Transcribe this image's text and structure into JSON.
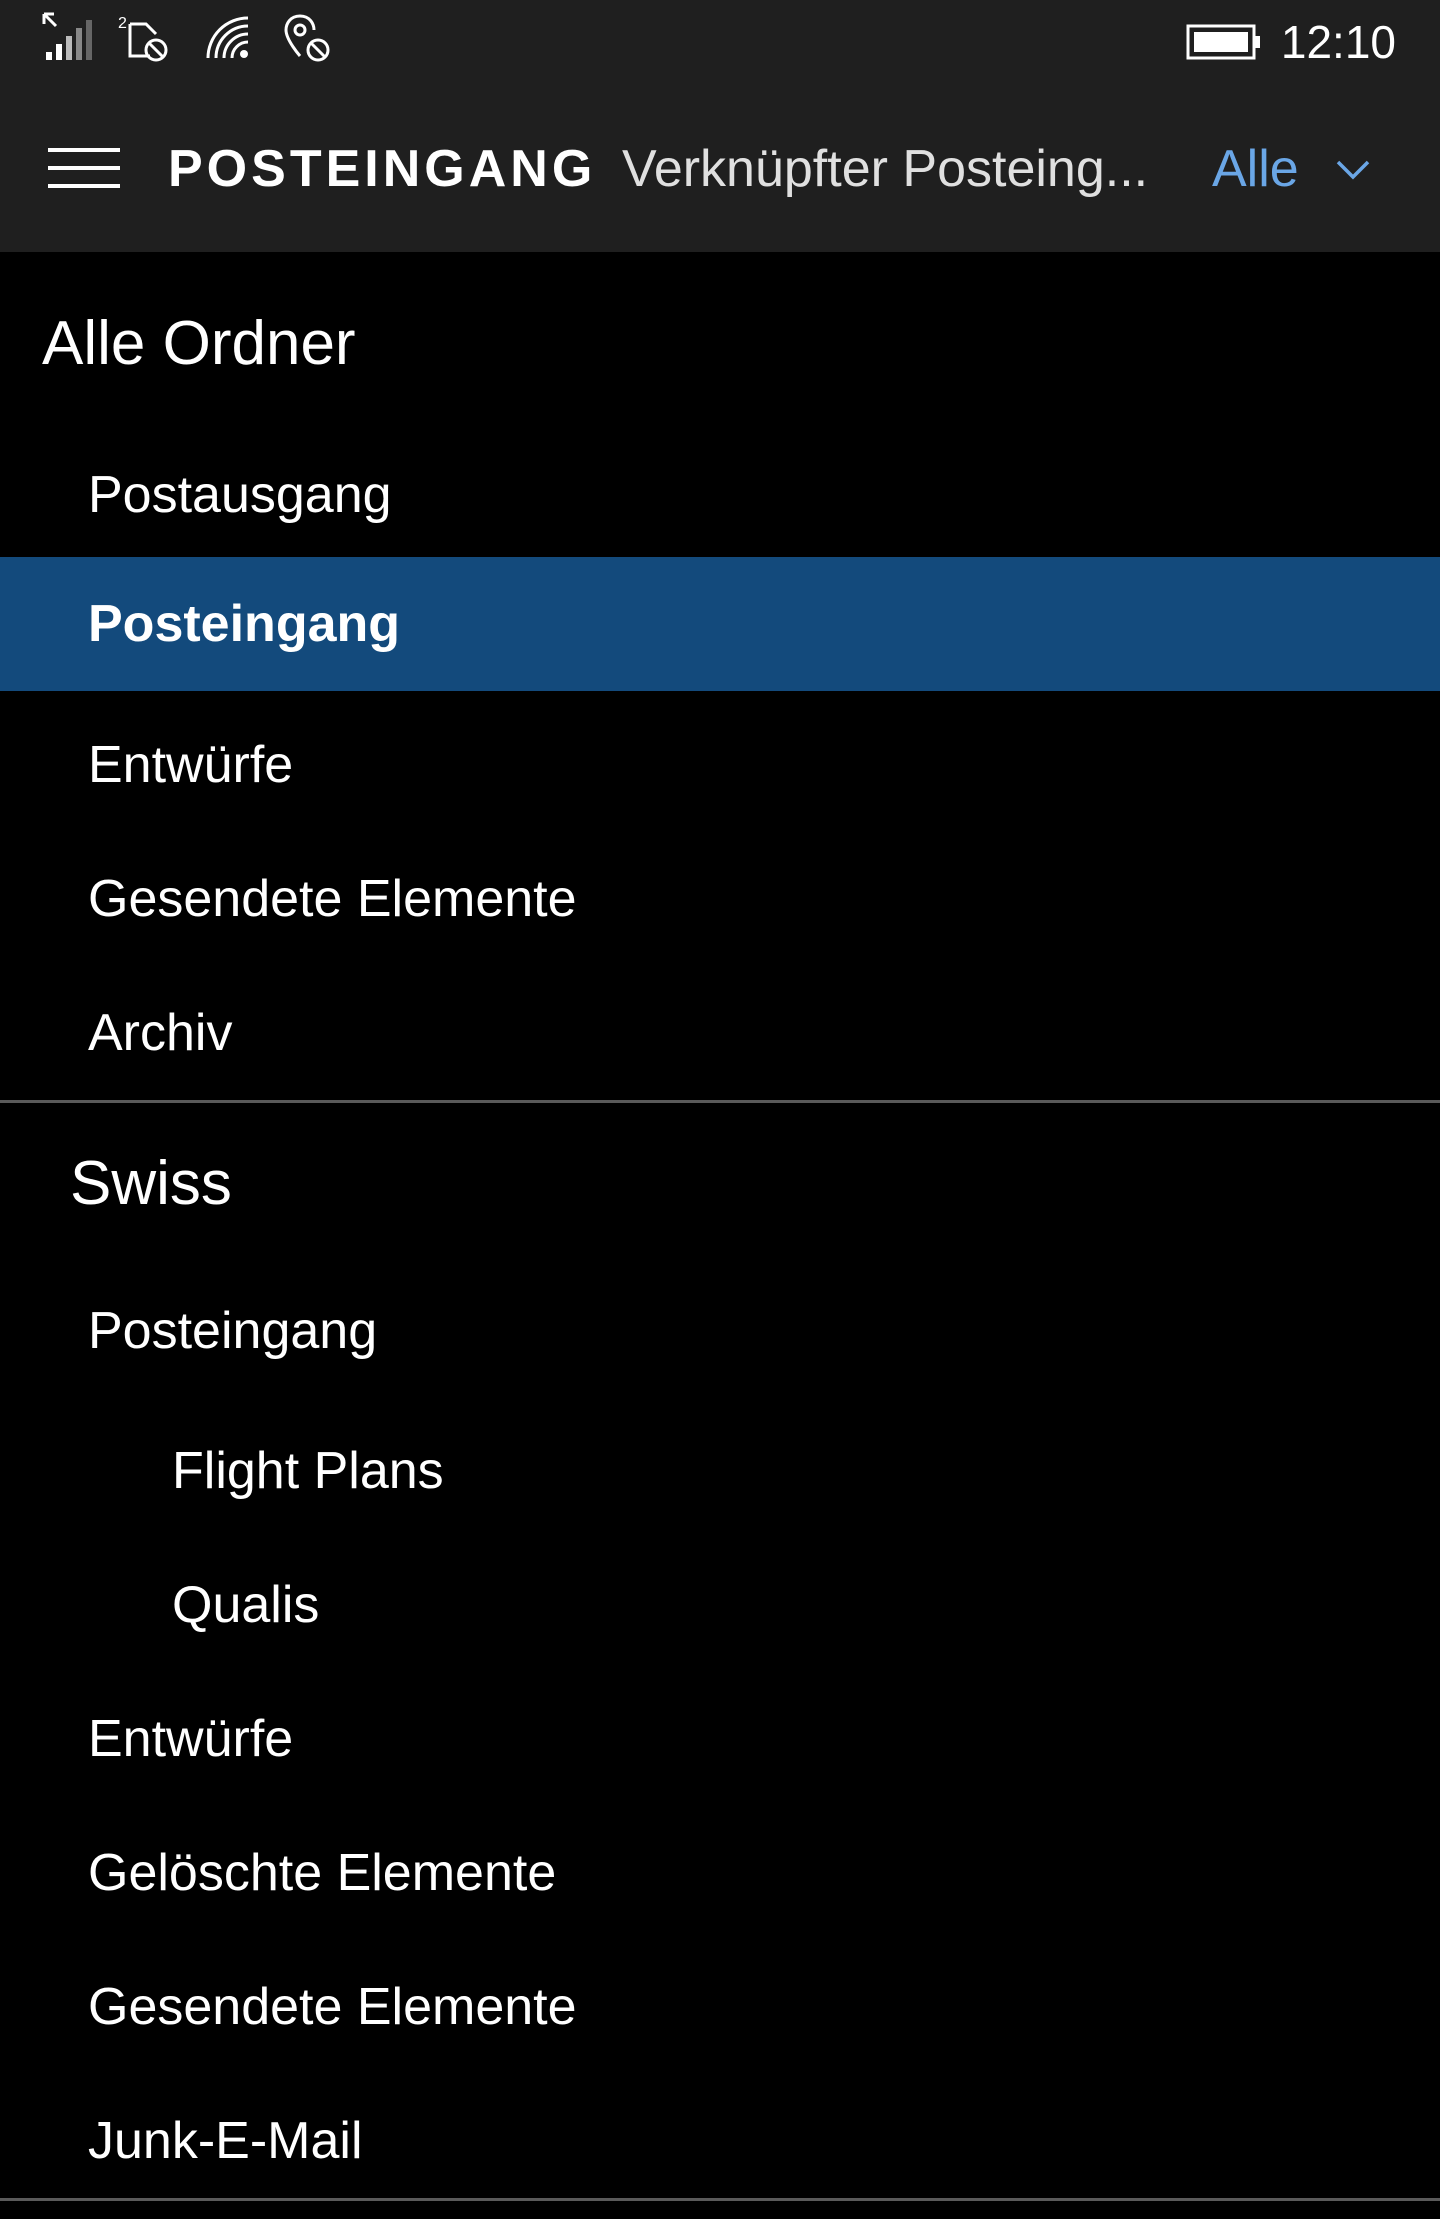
{
  "status_bar": {
    "icons": [
      "signal-strength-icon",
      "sim2-no-data-icon",
      "wifi-icon",
      "location-off-icon",
      "battery-icon"
    ],
    "time": "12:10"
  },
  "header": {
    "title": "POSTEINGANG",
    "account": "Verknüpfter Posteing...",
    "filter": "Alle",
    "icons": [
      "hamburger-menu-icon",
      "chevron-down-icon"
    ]
  },
  "sections": [
    {
      "title": "Alle Ordner",
      "folders": [
        {
          "label": "Postausgang",
          "selected": false
        },
        {
          "label": "Posteingang",
          "selected": true
        },
        {
          "label": "Entwürfe",
          "selected": false
        },
        {
          "label": "Gesendete Elemente",
          "selected": false
        },
        {
          "label": "Archiv",
          "selected": false
        }
      ]
    },
    {
      "title": "Swiss",
      "folders": [
        {
          "label": "Posteingang",
          "selected": false
        },
        {
          "label": "Flight Plans",
          "selected": false
        },
        {
          "label": "Qualis",
          "selected": false
        },
        {
          "label": "Entwürfe",
          "selected": false
        },
        {
          "label": "Gelöschte Elemente",
          "selected": false
        },
        {
          "label": "Gesendete Elemente",
          "selected": false
        },
        {
          "label": "Junk-E-Mail",
          "selected": false
        }
      ]
    }
  ],
  "colors": {
    "background": "#000000",
    "bar": "#1f1f1f",
    "selection": "#134a7c",
    "accent": "#6aa6e6"
  }
}
